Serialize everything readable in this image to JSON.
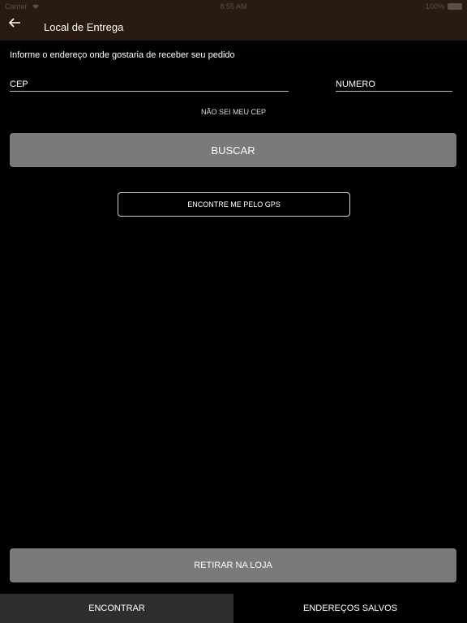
{
  "status_bar": {
    "carrier": "Carrier",
    "time": "8:55 AM",
    "battery": "100%"
  },
  "header": {
    "title": "Local de Entrega",
    "back_icon": "arrow-left-icon"
  },
  "form": {
    "intro": "Informe o endereço onde gostaria de receber seu pedido",
    "cep_placeholder": "CEP",
    "numero_placeholder": "NÚMERO",
    "no_cep_link": "NÃO SEI MEU CEP",
    "search_button": "BUSCAR",
    "gps_button": "ENCONTRE ME PELO GPS"
  },
  "pickup_button": "RETIRAR NA LOJA",
  "tabs": [
    {
      "label": "ENCONTRAR"
    },
    {
      "label": "ENDEREÇOS SALVOS"
    }
  ],
  "colors": {
    "header_bg": "#2a1b12",
    "button_gray": "#7a7a7a",
    "active_tab": "#2e2e2e"
  }
}
